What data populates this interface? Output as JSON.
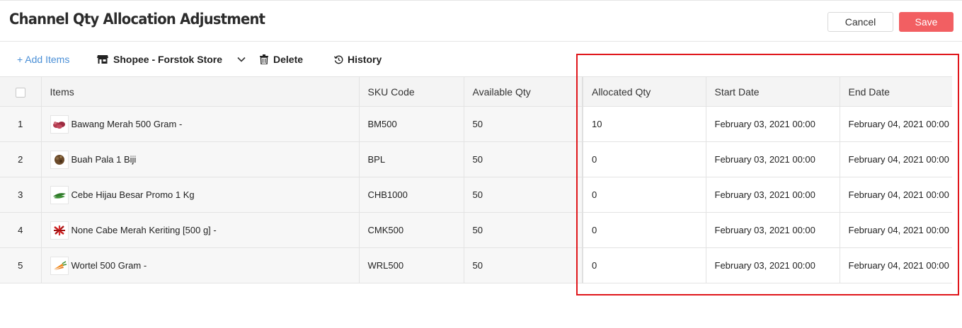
{
  "header": {
    "title": "Channel Qty Allocation Adjustment",
    "cancel_label": "Cancel",
    "save_label": "Save"
  },
  "toolbar": {
    "add_items_label": "+ Add Items",
    "store_label": "Shopee - Forstok Store",
    "delete_label": "Delete",
    "history_label": "History"
  },
  "table": {
    "columns": [
      "Items",
      "SKU Code",
      "Available Qty",
      "Allocated Qty",
      "Start Date",
      "End Date"
    ],
    "rows": [
      {
        "no": "1",
        "item": "Bawang Merah 500 Gram -",
        "thumb_icon": "shallot-icon",
        "sku": "BM500",
        "available": "50",
        "allocated": "10",
        "start": "February 03, 2021 00:00",
        "end": "February 04, 2021 00:00"
      },
      {
        "no": "2",
        "item": "Buah Pala 1 Biji",
        "thumb_icon": "nutmeg-icon",
        "sku": "BPL",
        "available": "50",
        "allocated": "0",
        "start": "February 03, 2021 00:00",
        "end": "February 04, 2021 00:00"
      },
      {
        "no": "3",
        "item": "Cebe Hijau Besar Promo 1 Kg",
        "thumb_icon": "green-chili-icon",
        "sku": "CHB1000",
        "available": "50",
        "allocated": "0",
        "start": "February 03, 2021 00:00",
        "end": "February 04, 2021 00:00"
      },
      {
        "no": "4",
        "item": "None Cabe Merah Keriting [500 g] -",
        "thumb_icon": "red-chili-icon",
        "sku": "CMK500",
        "available": "50",
        "allocated": "0",
        "start": "February 03, 2021 00:00",
        "end": "February 04, 2021 00:00"
      },
      {
        "no": "5",
        "item": "Wortel 500 Gram -",
        "thumb_icon": "carrot-icon",
        "sku": "WRL500",
        "available": "50",
        "allocated": "0",
        "start": "February 03, 2021 00:00",
        "end": "February 04, 2021 00:00"
      }
    ]
  },
  "colors": {
    "save": "#f25f62",
    "link": "#4a8fd6",
    "highlight": "#e0161b"
  }
}
